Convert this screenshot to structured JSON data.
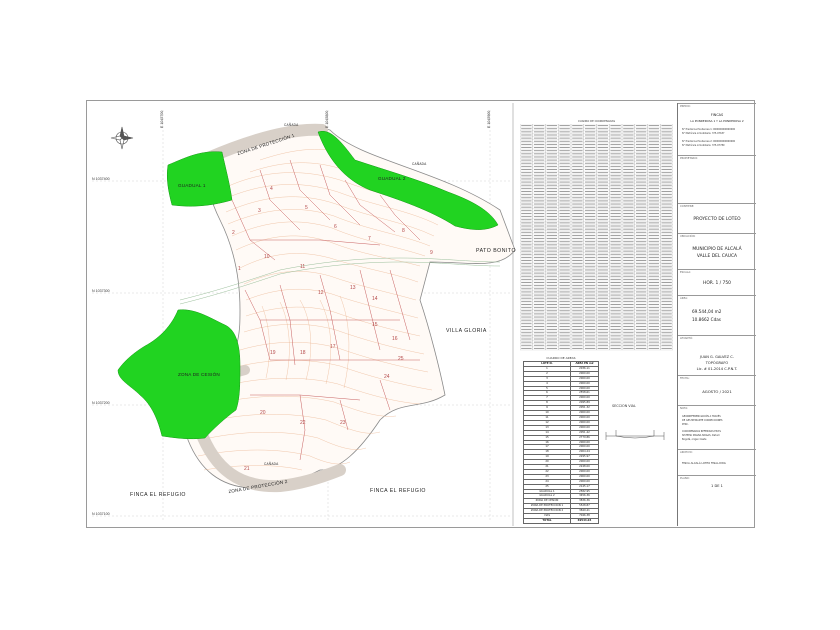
{
  "grid": {
    "east_labels": [
      "E 1045700",
      "E 1045800",
      "E 1045900"
    ],
    "north_labels": [
      "N 1037400",
      "N 1037300",
      "N 1037200",
      "N 1037100"
    ]
  },
  "map": {
    "labels": {
      "protection_1": "ZONA DE PROTECCIÓN 1",
      "protection_2": "ZONA DE PROTECCIÓN 2",
      "protection_3": "ZONA DE CESIÓN",
      "guadual_1": "GUADUAL 1",
      "guadual_2": "GUADUAL 2",
      "villa_gloria": "VILLA GLORIA",
      "pato_bonito": "PATO BONITO",
      "finca_left": "FINCA EL REFUGIO",
      "finca_right": "FINCA EL REFUGIO",
      "canada_top": "CAÑADA",
      "canada_top2": "CAÑADA",
      "canada_bottom": "CAÑADA"
    },
    "lots": [
      "1",
      "2",
      "3",
      "4",
      "5",
      "6",
      "7",
      "8",
      "9",
      "10",
      "11",
      "12",
      "13",
      "14",
      "15",
      "16",
      "17",
      "18",
      "19",
      "20",
      "21",
      "22",
      "23",
      "24",
      "25"
    ],
    "colors": {
      "green": "#21d321",
      "road": "#d8d0c8",
      "contour": "#e9b08a",
      "lot_line": "#c86060"
    }
  },
  "coord_table": {
    "title": "CUADRO DE COORDENADAS",
    "columns": 12,
    "rows": 72
  },
  "areas_table": {
    "title": "CUADRO DE AREAS",
    "headers": [
      "LOTE N.",
      "ÁREA EN m2"
    ],
    "rows": [
      [
        "1",
        "2036.11"
      ],
      [
        "2",
        "2000.00"
      ],
      [
        "3",
        "2000.00"
      ],
      [
        "4",
        "2000.00"
      ],
      [
        "5",
        "2000.00"
      ],
      [
        "6",
        "2558.61"
      ],
      [
        "7",
        "2000.00"
      ],
      [
        "8",
        "2095.89"
      ],
      [
        "9",
        "2051.32"
      ],
      [
        "10",
        "2000.00"
      ],
      [
        "11",
        "2000.00"
      ],
      [
        "12",
        "2000.00"
      ],
      [
        "13",
        "2000.00"
      ],
      [
        "14",
        "2051.42"
      ],
      [
        "15",
        "2779.86"
      ],
      [
        "16",
        "2000.00"
      ],
      [
        "17",
        "2000.00"
      ],
      [
        "18",
        "2004.24"
      ],
      [
        "19",
        "2295.97"
      ],
      [
        "20",
        "2000.00"
      ],
      [
        "21",
        "2248.00"
      ],
      [
        "22",
        "2000.00"
      ],
      [
        "23",
        "2000.00"
      ],
      [
        "24",
        "2000.00"
      ],
      [
        "25",
        "2145.17"
      ]
    ],
    "extra": [
      [
        "GUADUAL 1",
        "2582.95"
      ],
      [
        "GUADUAL 2",
        "3456.36"
      ],
      [
        "ZONA DE CESIÓN",
        "3836.36"
      ],
      [
        "ZONA DE PROTECCIÓN 1",
        "5528.87"
      ],
      [
        "ZONA DE PROTECCIÓN 2",
        "3849.41"
      ],
      [
        "VÍAS",
        "7046.38"
      ]
    ],
    "total": [
      "TOTAL",
      "69544.04"
    ]
  },
  "section": {
    "title": "SECCION VIAL"
  },
  "title_block": {
    "predio_head": "PREDIO:",
    "predio_name": "FINCAS",
    "predio_sub": "LA PONDEROSA 1 Y LA PONDEROSA 2",
    "predio_lines": [
      "N° Predial La Ponderosa 1: 000000000000000",
      "N° Matrícula inmobiliaria: 375-97637",
      "N° Predial La Ponderosa 2: 000000000000000",
      "N° Matrícula inmobiliaria: 375-97789"
    ],
    "propietario_head": "PROPIETARIO:",
    "contiene_head": "CONTIENE:",
    "contiene_val": "PROYECTO DE LOTEO",
    "ubicacion_head": "UBICACIÓN:",
    "ubicacion_val": "MUNICIPIO DE ALCALÁ VALLE DEL CAUCA",
    "escala_head": "ESCALA:",
    "escala_val": "HOR. 1 / 750",
    "area_head": "ÁREA:",
    "area_m2": "69.544,04 m2",
    "area_has": "10.8662 Cdas",
    "levanto_head": "LEVANTÓ:",
    "levanto_name": "JUAN G. GALVEZ C.",
    "levanto_title": "TOPÓGRAFO",
    "levanto_lic": "Lic. # 01-2014 C.P.N.T.",
    "fecha_head": "FECHA:",
    "fecha_val": "AGOSTO / 2021",
    "nota_head": "NOTA:",
    "nota_lines": [
      "GEORREFERENCIACIÓN A TRAVÉS",
      "DE GPS MEDIANTE CORRECCIONES",
      "RTKC.",
      "COORDENADAS REFERIDAS EN EL",
      "SISTEMA MAGNA SIRGAS, Datum",
      "Bogotá, origen Oeste"
    ],
    "archivo_head": "ARCHIVO:",
    "archivo_val": "FINCA ALCALÁ LOTEO FINAL.DWG",
    "plano_head": "PLANO:",
    "plano_val": "1 DE 1"
  }
}
